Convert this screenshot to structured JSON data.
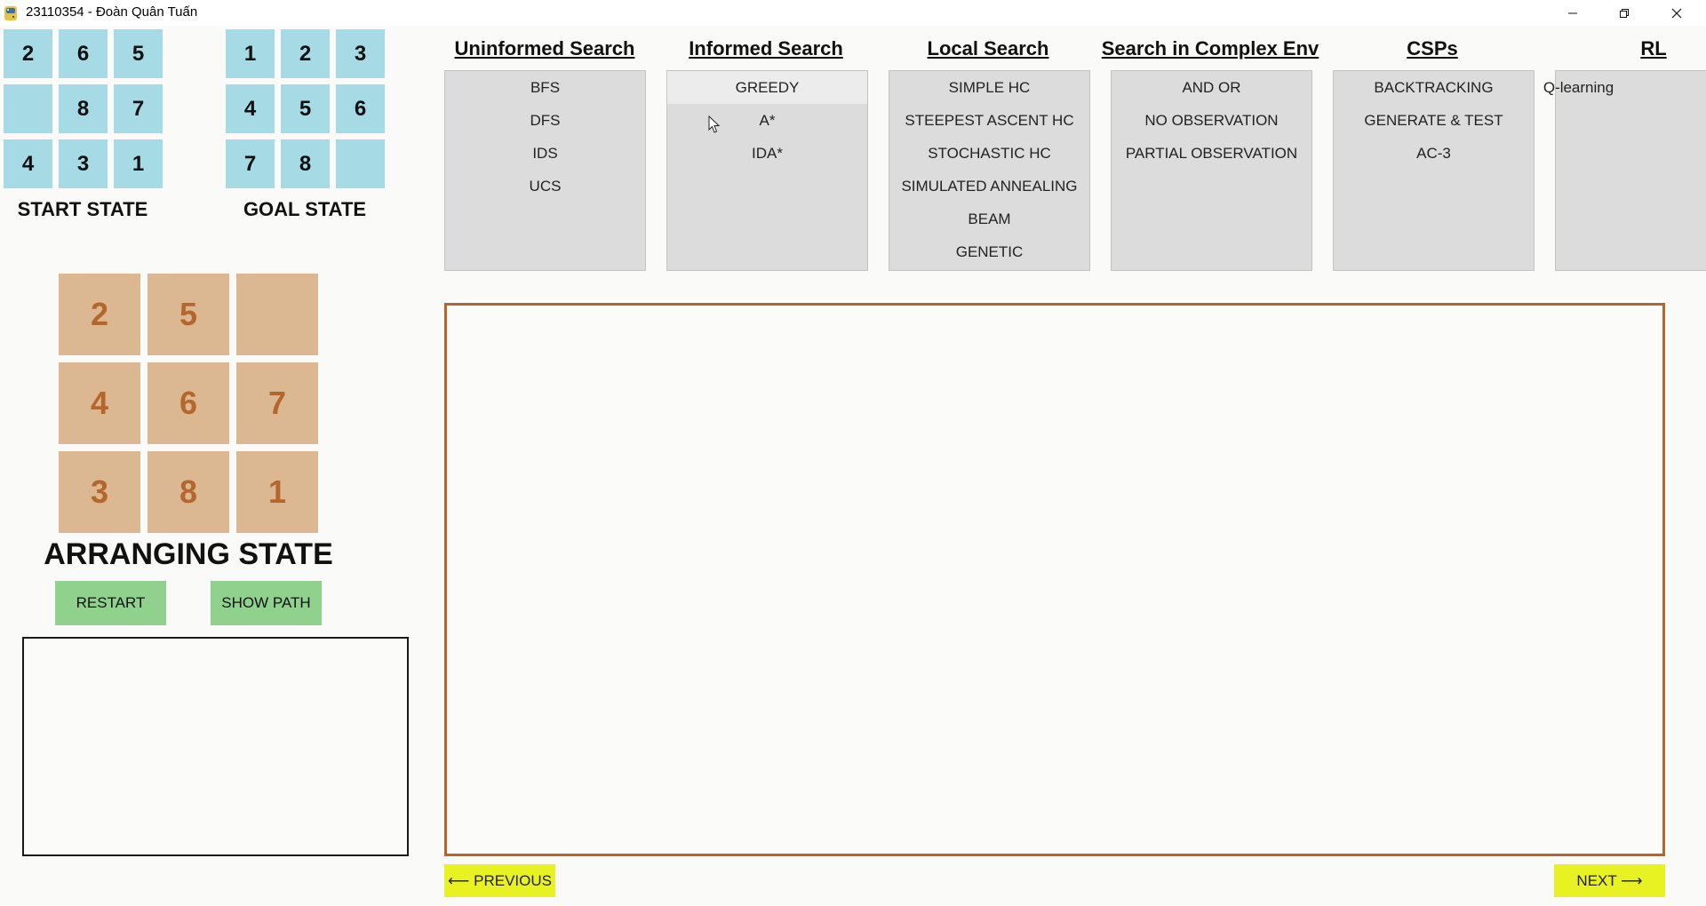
{
  "window": {
    "title": "23110354 - Đoàn Quân Tuấn"
  },
  "start_state": {
    "label": "START STATE",
    "tiles": [
      "2",
      "6",
      "5",
      "",
      "8",
      "7",
      "4",
      "3",
      "1"
    ]
  },
  "goal_state": {
    "label": "GOAL STATE",
    "tiles": [
      "1",
      "2",
      "3",
      "4",
      "5",
      "6",
      "7",
      "8",
      ""
    ]
  },
  "arranging_state": {
    "label": "ARRANGING STATE",
    "tiles": [
      "2",
      "5",
      "",
      "4",
      "6",
      "7",
      "3",
      "8",
      "1"
    ]
  },
  "buttons": {
    "restart": "RESTART",
    "show_path": "SHOW PATH",
    "previous": "⟵ PREVIOUS",
    "next": "NEXT ⟶"
  },
  "categories": [
    {
      "title": "Uninformed Search",
      "items": [
        "BFS",
        "DFS",
        "IDS",
        "UCS"
      ]
    },
    {
      "title": "Informed Search",
      "items": [
        "GREEDY",
        "A*",
        "IDA*"
      ]
    },
    {
      "title": "Local Search",
      "items": [
        "SIMPLE HC",
        "STEEPEST ASCENT HC",
        "STOCHASTIC HC",
        "SIMULATED ANNEALING",
        "BEAM",
        "GENETIC"
      ]
    },
    {
      "title": "Search in Complex Env",
      "items": [
        "AND OR",
        "NO OBSERVATION",
        "PARTIAL OBSERVATION"
      ]
    },
    {
      "title": "CSPs",
      "items": [
        "BACKTRACKING",
        "GENERATE & TEST",
        "AC-3"
      ]
    },
    {
      "title": "RL",
      "items": [
        "Q-learning"
      ]
    }
  ],
  "hovered_item": "GREEDY",
  "colors": {
    "state_tile": "#a6dbe6",
    "arranging_tile": "#dcb892",
    "arranging_number": "#b4662c",
    "green_button": "#8fd18d",
    "yellow_button": "#e8f222",
    "panel": "#dcdcdc",
    "display_border": "#b4662c"
  },
  "icons": {
    "app": "python-icon",
    "minimize": "minimize-icon",
    "restore": "restore-icon",
    "close": "close-icon",
    "pointer": "mouse-pointer-icon"
  }
}
